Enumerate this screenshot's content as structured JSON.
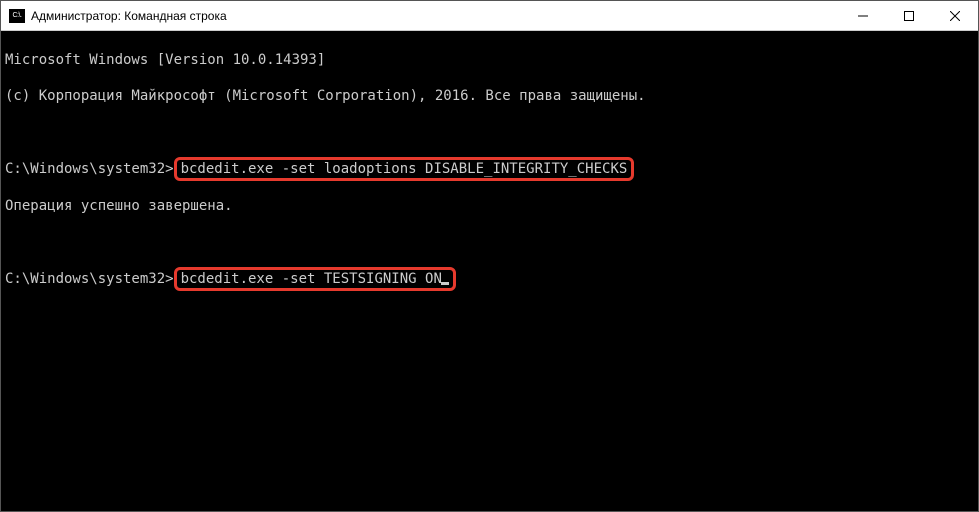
{
  "window": {
    "title": "Администратор: Командная строка",
    "icon_label": "C:\\."
  },
  "terminal": {
    "banner_line1": "Microsoft Windows [Version 10.0.14393]",
    "banner_line2": "(c) Корпорация Майкрософт (Microsoft Corporation), 2016. Все права защищены.",
    "prompt": "C:\\Windows\\system32>",
    "cmd1": "bcdedit.exe -set loadoptions DISABLE_INTEGRITY_CHECKS",
    "result1": "Операция успешно завершена.",
    "cmd2": "bcdedit.exe -set TESTSIGNING ON"
  },
  "highlight_color": "#e63a2d"
}
